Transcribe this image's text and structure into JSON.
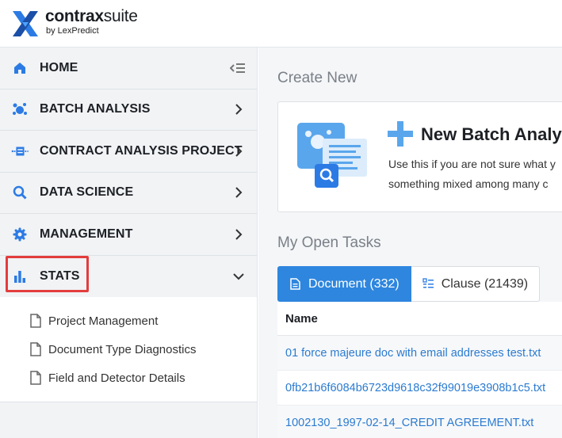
{
  "brand": {
    "name_bold": "contrax",
    "name_thin": "suite",
    "byline": "by LexPredict"
  },
  "sidebar": {
    "items": [
      {
        "label": "HOME",
        "icon": "home-icon"
      },
      {
        "label": "BATCH ANALYSIS",
        "icon": "batch-analysis-icon"
      },
      {
        "label": "CONTRACT ANALYSIS PROJECT",
        "icon": "contract-project-icon"
      },
      {
        "label": "DATA SCIENCE",
        "icon": "search-icon"
      },
      {
        "label": "MANAGEMENT",
        "icon": "gear-icon"
      },
      {
        "label": "STATS",
        "icon": "bar-chart-icon"
      }
    ],
    "stats_submenu": [
      {
        "label": "Project Management"
      },
      {
        "label": "Document Type Diagnostics"
      },
      {
        "label": "Field and Detector Details"
      }
    ]
  },
  "main": {
    "create_new_title": "Create New",
    "card": {
      "title": "New Batch Analy",
      "desc_line1": "Use this if you are not sure what y",
      "desc_line2": "something mixed among many c"
    },
    "open_tasks_title": "My Open Tasks",
    "tabs": [
      {
        "label": "Document (332)",
        "active": true
      },
      {
        "label": "Clause (21439)",
        "active": false
      }
    ],
    "table": {
      "header": "Name",
      "rows": [
        "01 force majeure doc with email addresses test.txt",
        "0fb21b6f6084b6723d9618c32f99019e3908b1c5.txt",
        "1002130_1997-02-14_CREDIT AGREEMENT.txt"
      ]
    }
  },
  "colors": {
    "accent": "#2e86de",
    "highlight": "#e33d3d",
    "icon_blue": "#2c7be5"
  }
}
